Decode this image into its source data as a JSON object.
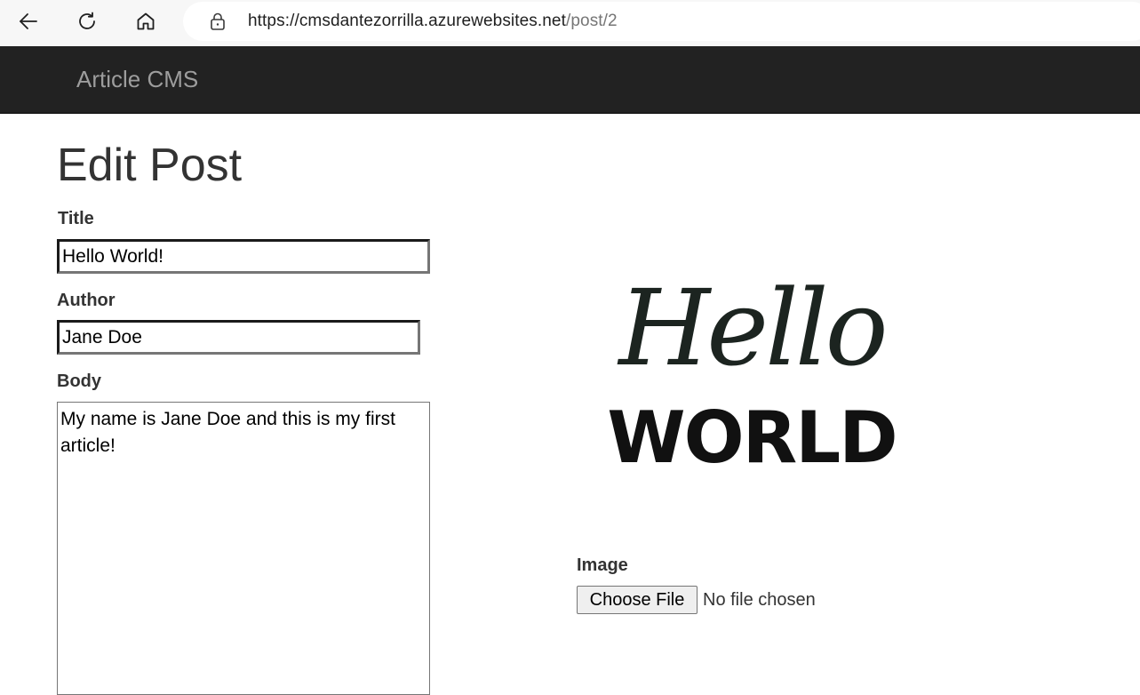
{
  "browser": {
    "url_host": "https://cmsdantezorrilla.azurewebsites.net",
    "url_path": "/post/2"
  },
  "navbar": {
    "brand": "Article CMS"
  },
  "page": {
    "title": "Edit Post"
  },
  "form": {
    "title_label": "Title",
    "title_value": "Hello World!",
    "author_label": "Author",
    "author_value": "Jane Doe",
    "body_label": "Body",
    "body_value": "My name is Jane Doe and this is my first article!",
    "image_label": "Image",
    "choose_file_label": "Choose File",
    "file_status": "No file chosen"
  },
  "image": {
    "script_text": "Hello",
    "block_text": "WORLD"
  },
  "colors": {
    "navbar_bg": "#222222",
    "brand_text": "#9d9d9d",
    "image_ink": "#1c2420"
  },
  "icons": [
    "back-arrow-icon",
    "reload-icon",
    "home-icon",
    "lock-icon"
  ]
}
